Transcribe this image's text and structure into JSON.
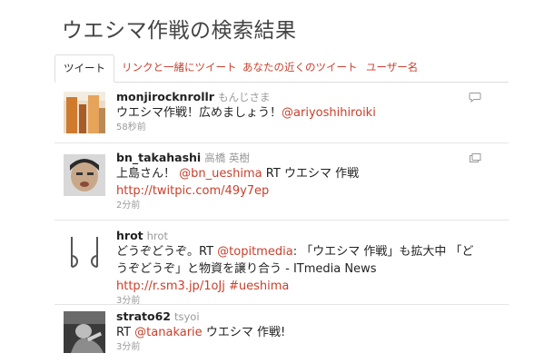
{
  "header": {
    "title": "ウエシマ作戦の検索結果"
  },
  "tabs": [
    {
      "label": "ツイート",
      "active": true
    },
    {
      "label": "リンクと一緒にツイート",
      "active": false
    },
    {
      "label": "あなたの近くのツイート",
      "active": false
    },
    {
      "label": "ユーザー名",
      "active": false
    }
  ],
  "tweets": [
    {
      "username": "monjirocknrollr",
      "realname": "もんじさま",
      "text": "ウエシマ作戦！広めましょう！",
      "mention": "@ariyoshihiroiki",
      "time": "58秒前",
      "icon": "reply-icon"
    },
    {
      "username": "bn_takahashi",
      "realname": "高橋 英樹",
      "text_a": "上島さん！",
      "mention": "@bn_ueshima",
      "text_b": "RT ウエシマ 作戦",
      "url": "http://twitpic.com/49y7ep",
      "time": "2分前",
      "icon": "retweet-icon"
    },
    {
      "username": "hrot",
      "realname": "hrot",
      "text_a": "どうぞどうぞ。RT",
      "mention": "@topitmedia",
      "text_b": ": 「ウエシマ 作戦」も拡大中 「どうぞどうぞ」と物資を譲り合う - ITmedia News",
      "url": "http://r.sm3.jp/1oJj",
      "hashtag": "#ueshima",
      "time": "3分前"
    },
    {
      "username": "strato62",
      "realname": "tsyoi",
      "text_a": "RT",
      "mention": "@tanakarie",
      "text_b": "ウエシマ 作戦!",
      "time": "3分前"
    }
  ],
  "colors": {
    "link": "#c8402c",
    "muted": "#999999"
  }
}
